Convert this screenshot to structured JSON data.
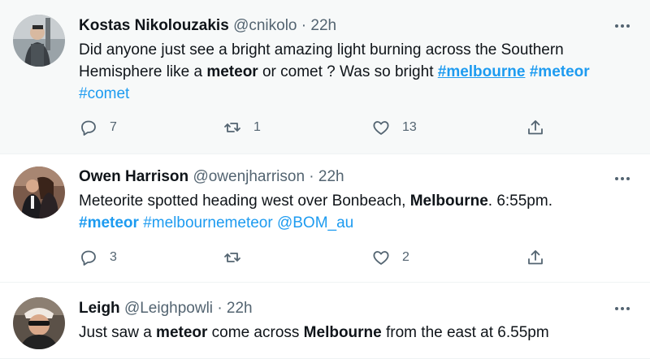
{
  "tweets": [
    {
      "name": "Kostas Nikolouzakis",
      "handle": "@cnikolo",
      "dot": "·",
      "time": "22h",
      "text": {
        "p1": "Did anyone just see a bright amazing light burning across the Southern Hemisphere like a ",
        "b1": "meteor",
        "p2": " or comet ? Was so bright ",
        "tag1": "#melbourne",
        "tag2": "#meteor",
        "tag3": "#comet"
      },
      "replies": "7",
      "retweets": "1",
      "likes": "13"
    },
    {
      "name": "Owen Harrison",
      "handle": "@owenjharrison",
      "dot": "·",
      "time": "22h",
      "text": {
        "p1": "Meteorite spotted heading west over Bonbeach, ",
        "b1": "Melbourne",
        "p2": ". 6:55pm.",
        "tag1": "#meteor",
        "tag2": "#melbournemeteor",
        "mention": "@BOM_au"
      },
      "replies": "3",
      "retweets": "",
      "likes": "2"
    },
    {
      "name": "Leigh",
      "handle": "@Leighpowli",
      "dot": "·",
      "time": "22h",
      "text": {
        "p1": "Just saw a ",
        "b1": "meteor",
        "p2": " come across ",
        "b2": "Melbourne",
        "p3": " from the east at 6.55pm"
      }
    }
  ],
  "colors": {
    "accent": "#1d9bf0",
    "muted": "#536471",
    "text": "#0f1419",
    "hover_bg": "#f7f9f9"
  },
  "icons": [
    "reply-icon",
    "retweet-icon",
    "like-icon",
    "share-icon",
    "more-icon"
  ]
}
